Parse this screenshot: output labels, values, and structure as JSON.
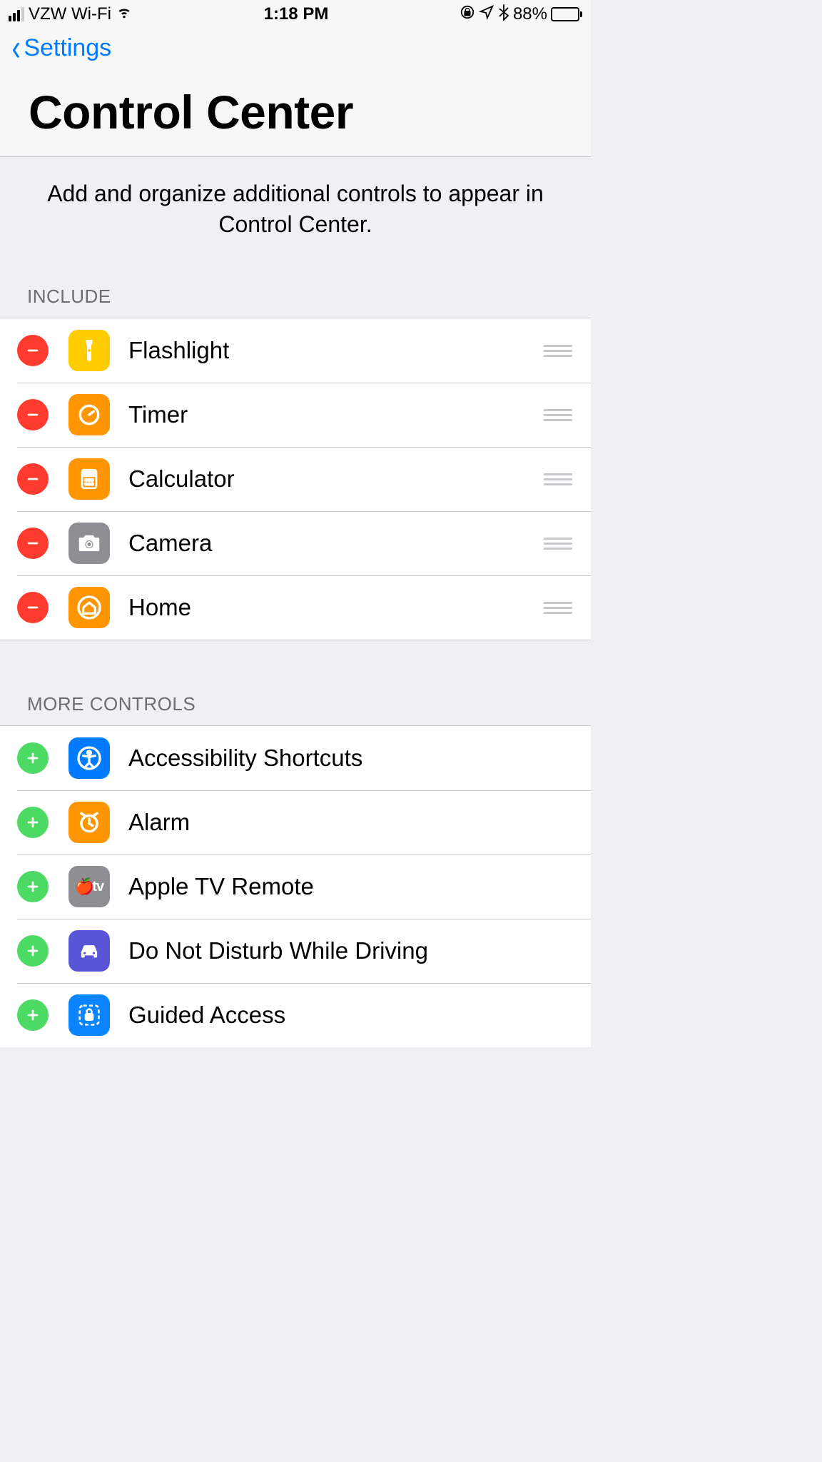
{
  "statusBar": {
    "carrier": "VZW Wi-Fi",
    "time": "1:18 PM",
    "batteryPct": "88%"
  },
  "nav": {
    "backLabel": "Settings"
  },
  "title": "Control Center",
  "description": "Add and organize additional controls to appear in Control Center.",
  "sections": {
    "includeHeader": "Include",
    "moreHeader": "More Controls"
  },
  "include": [
    {
      "label": "Flashlight",
      "iconName": "flashlight-icon",
      "iconClass": "ic-yellow"
    },
    {
      "label": "Timer",
      "iconName": "timer-icon",
      "iconClass": "ic-orange"
    },
    {
      "label": "Calculator",
      "iconName": "calculator-icon",
      "iconClass": "ic-orange"
    },
    {
      "label": "Camera",
      "iconName": "camera-icon",
      "iconClass": "ic-gray"
    },
    {
      "label": "Home",
      "iconName": "home-icon",
      "iconClass": "ic-orange"
    }
  ],
  "more": [
    {
      "label": "Accessibility Shortcuts",
      "iconName": "accessibility-icon",
      "iconClass": "ic-blue"
    },
    {
      "label": "Alarm",
      "iconName": "alarm-icon",
      "iconClass": "ic-orange"
    },
    {
      "label": "Apple TV Remote",
      "iconName": "appletv-icon",
      "iconClass": "ic-gray"
    },
    {
      "label": "Do Not Disturb While Driving",
      "iconName": "dnd-driving-icon",
      "iconClass": "ic-purple"
    },
    {
      "label": "Guided Access",
      "iconName": "guided-access-icon",
      "iconClass": "ic-blue2"
    }
  ]
}
